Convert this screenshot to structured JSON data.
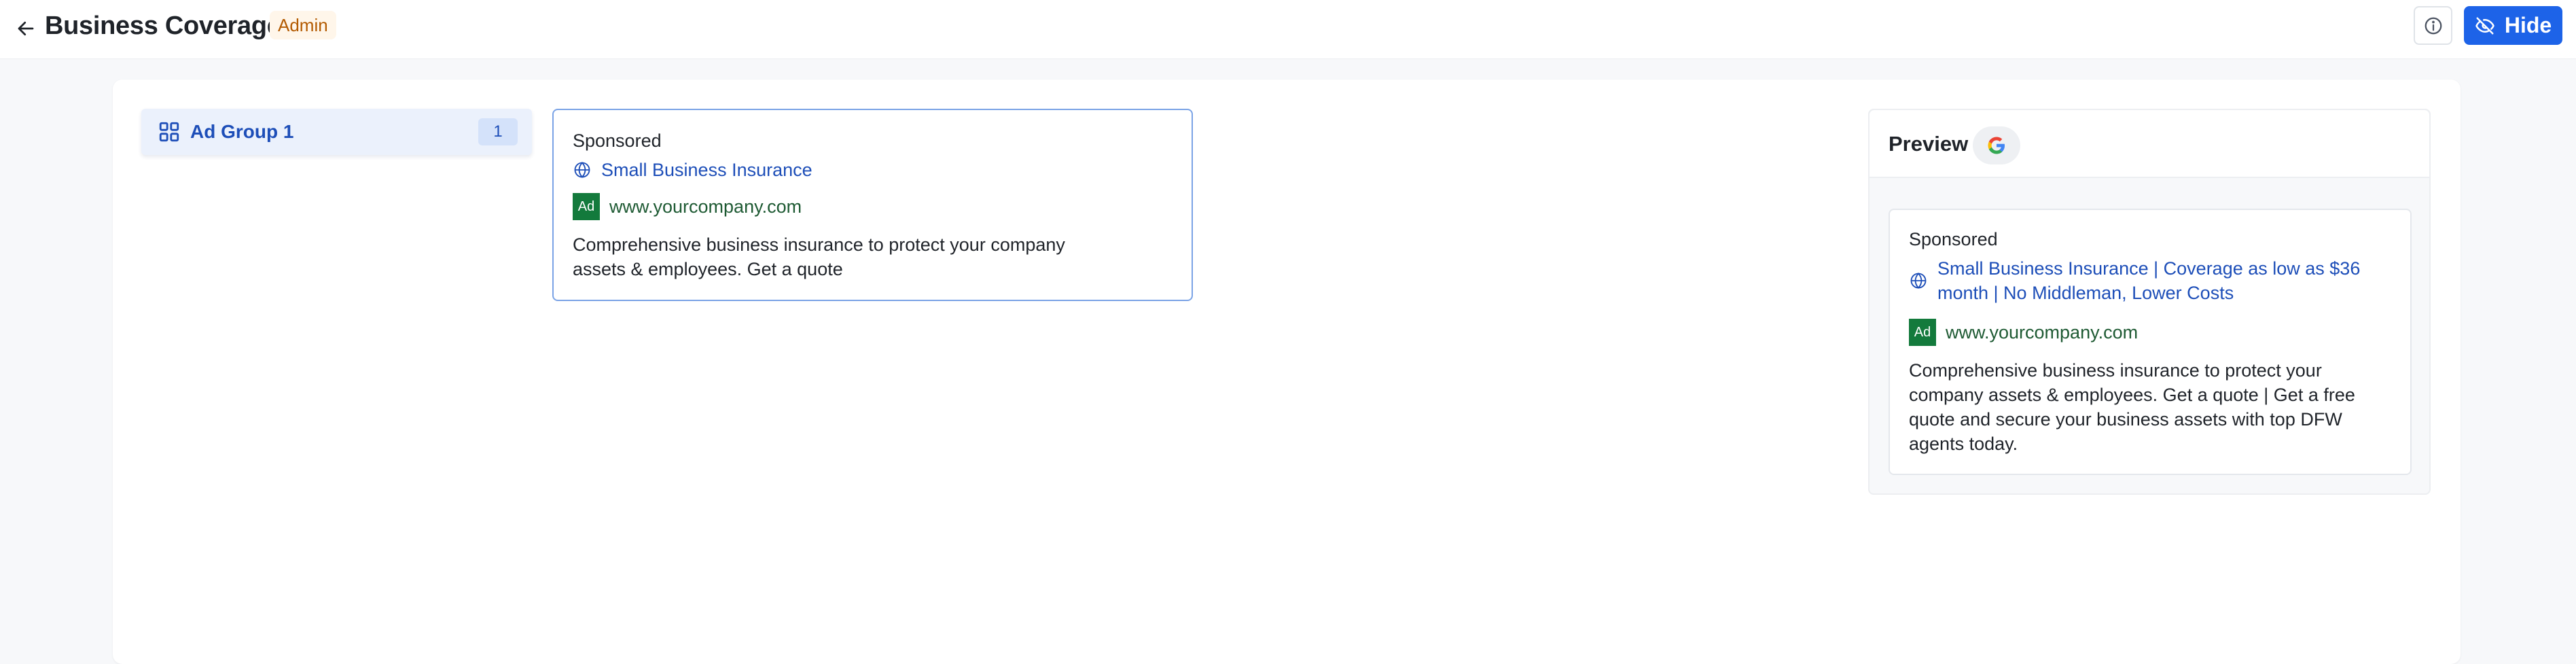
{
  "header": {
    "title": "Business Coverage",
    "role_badge": "Admin",
    "hide_label": "Hide"
  },
  "ad_groups": [
    {
      "label": "Ad Group 1",
      "count": "1"
    }
  ],
  "ad_card": {
    "sponsored": "Sponsored",
    "headline": "Small Business Insurance",
    "badge": "Ad",
    "url": "www.yourcompany.com",
    "description_lines": [
      "Comprehensive business insurance to protect your company",
      "assets & employees. Get a quote"
    ]
  },
  "preview": {
    "title": "Preview",
    "sponsored": "Sponsored",
    "headline_lines": [
      "Small Business Insurance | Coverage as low as $36",
      "month | No Middleman, Lower Costs"
    ],
    "badge": "Ad",
    "url": "www.yourcompany.com",
    "description_lines": [
      "Comprehensive business insurance to protect your",
      "company assets & employees. Get a quote | Get a free",
      "quote and secure your business assets with top DFW",
      "agents today."
    ]
  },
  "icons": {
    "back": "arrow-left-icon",
    "info": "info-circle-icon",
    "hide": "eye-off-icon",
    "group": "grid-icon",
    "globe": "globe-icon",
    "google": "google-logo-icon"
  },
  "colors": {
    "accent": "#1d63e8",
    "link": "#1d4eb8",
    "ad_badge": "#137a3c",
    "admin_badge_bg": "#fff6ea",
    "admin_badge_text": "#b35a00"
  }
}
